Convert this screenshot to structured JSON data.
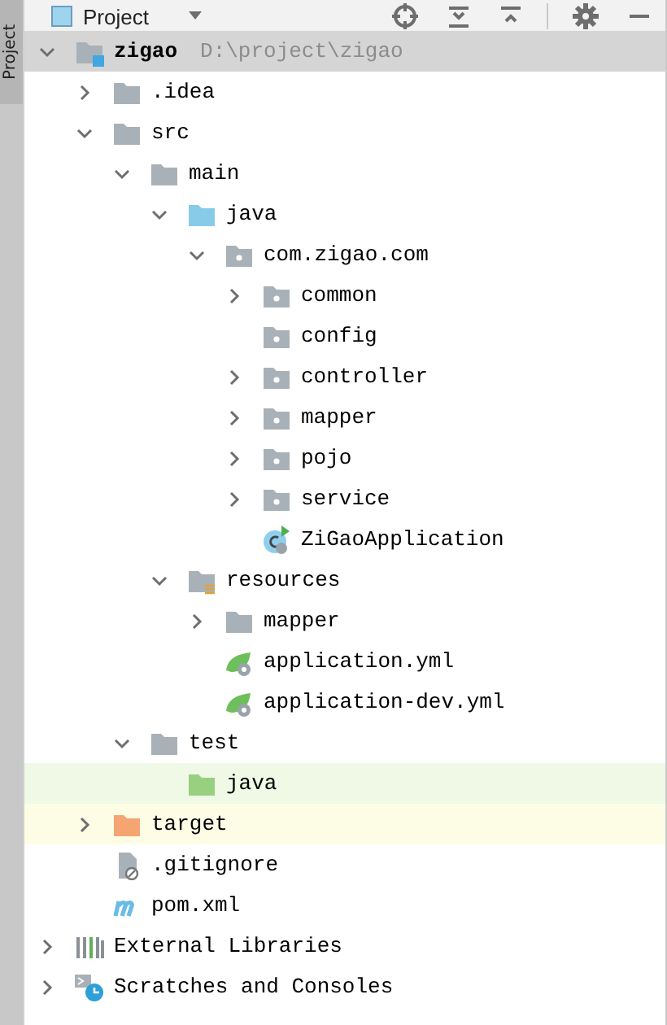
{
  "side_tab": {
    "label": "Project"
  },
  "header": {
    "title": "Project"
  },
  "tree": [
    {
      "label": "zigao",
      "path": "D:\\project\\zigao",
      "kind": "module",
      "expanded": true,
      "selected": true,
      "children": [
        {
          "label": ".idea",
          "kind": "folder",
          "expanded": false,
          "selected": false
        },
        {
          "label": "src",
          "kind": "folder",
          "expanded": true,
          "selected": false,
          "children": [
            {
              "label": "main",
              "kind": "folder",
              "expanded": true,
              "selected": false,
              "children": [
                {
                  "label": "java",
                  "kind": "sources",
                  "expanded": true,
                  "selected": false,
                  "children": [
                    {
                      "label": "com.zigao.com",
                      "kind": "package",
                      "expanded": true,
                      "selected": false,
                      "children": [
                        {
                          "label": "common",
                          "kind": "package",
                          "expanded": false,
                          "selected": false
                        },
                        {
                          "label": "config",
                          "kind": "package",
                          "selected": false
                        },
                        {
                          "label": "controller",
                          "kind": "package",
                          "expanded": false,
                          "selected": false
                        },
                        {
                          "label": "mapper",
                          "kind": "package",
                          "expanded": false,
                          "selected": false
                        },
                        {
                          "label": "pojo",
                          "kind": "package",
                          "expanded": false,
                          "selected": false
                        },
                        {
                          "label": "service",
                          "kind": "package",
                          "expanded": false,
                          "selected": false
                        },
                        {
                          "label": "ZiGaoApplication",
                          "kind": "app-class",
                          "selected": false
                        }
                      ]
                    }
                  ]
                },
                {
                  "label": "resources",
                  "kind": "resources",
                  "expanded": true,
                  "selected": false,
                  "children": [
                    {
                      "label": "mapper",
                      "kind": "folder",
                      "expanded": false,
                      "selected": false
                    },
                    {
                      "label": "application.yml",
                      "kind": "spring-config",
                      "selected": false
                    },
                    {
                      "label": "application-dev.yml",
                      "kind": "spring-config",
                      "selected": false
                    }
                  ]
                }
              ]
            },
            {
              "label": "test",
              "kind": "folder",
              "expanded": true,
              "selected": false,
              "children": [
                {
                  "label": "java",
                  "kind": "test-sources",
                  "selected": false
                }
              ]
            }
          ]
        },
        {
          "label": "target",
          "kind": "excluded",
          "expanded": false,
          "selected": false
        },
        {
          "label": ".gitignore",
          "kind": "ignore-file",
          "selected": false
        },
        {
          "label": "pom.xml",
          "kind": "maven",
          "selected": false
        }
      ]
    },
    {
      "label": "External Libraries",
      "kind": "libraries",
      "expanded": false,
      "selected": false
    },
    {
      "label": "Scratches and Consoles",
      "kind": "scratches",
      "expanded": false,
      "selected": false
    }
  ]
}
